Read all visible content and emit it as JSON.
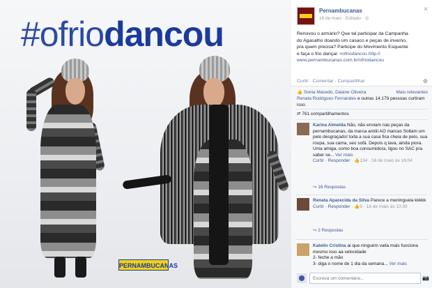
{
  "photo": {
    "headline_part1": "#ofrio",
    "headline_part2": "dancou",
    "brand_logo": "PERNAMBUCANAS"
  },
  "post": {
    "page_name": "Pernambucanas",
    "date": "16 de maio",
    "edited": "Editado",
    "text_lines": [
      "Renovou o armário? Que tal participar da Campanha",
      "do Agasalho doando um casaco e peças de inverno,",
      "pra quem precisa? Participe do Movimento Esquente",
      "e faça o frio dançar."
    ],
    "hashtag": "#ofriodancou",
    "link1": "http://",
    "link2": "www.pernambucanas.com.br/ofriodancou"
  },
  "actions": {
    "like": "Curtir",
    "comment": "Comentar",
    "share": "Compartilhar"
  },
  "feedback": {
    "likers_line1": "Sonia Macedo, Daiane Oliveira",
    "relevance": "Mais relevantes",
    "likers_line2": "e outras 14.179 pessoas curtiram isso.",
    "likers_prefix": "Renata Rodrigues Fernandes",
    "shares": "761 compartilhamentos"
  },
  "comments": [
    {
      "name": "Karina Almeida",
      "text": "Não, não enviam nas peças da pernambucanas, da marca amiiii AO marcas Soltam um pelo desgraçado! toda a sua casa fica cheia de pelo, sua roupa, sua cama, seu sofá. Depois q lava, ainda piora. Uma amiga, como boa consumidora, ligou no SAC pra saber se...",
      "see_more": "Ver mais",
      "meta_reply": "Curtir · Responder",
      "meta_likes": "134",
      "meta_date": "16 de maio às 16:04",
      "replies": "16 Respostas"
    },
    {
      "name": "Renata Aparecida da Silva",
      "text": "Parece a meninguela kkkkk",
      "meta_reply": "Curtir · Responder",
      "meta_likes": "5",
      "meta_date": "16 de maio às 13:30",
      "replies": "2 Respostas"
    },
    {
      "name": "Katelin Cristina",
      "text": "ai que ninguém valia mais funciona mesmo isso aa velocidade",
      "line2": "2- feche a mão",
      "line3": "3- diga o nome de 1 dia da semana...",
      "see_more": "Ver mais"
    }
  ],
  "write_comment": {
    "placeholder": "Escreva um comentário..."
  },
  "icons": [
    "close-icon",
    "globe-icon",
    "gear-icon",
    "like-icon",
    "share-icon",
    "camera-icon"
  ]
}
